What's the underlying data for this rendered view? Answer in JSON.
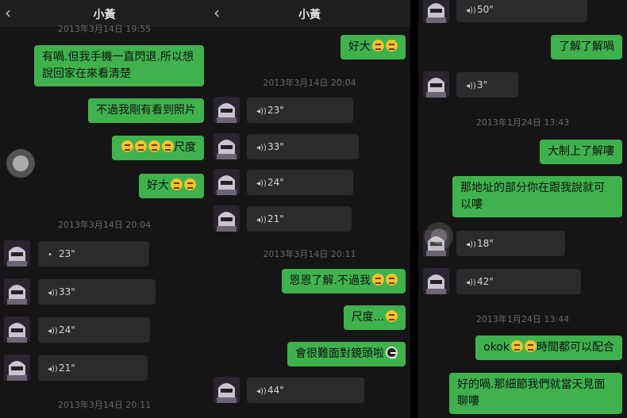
{
  "panel1": {
    "header": {
      "back_icon": "‹",
      "title": "小黃"
    },
    "timestamps": [
      "2013年3月14日 19:55",
      "2013年3月14日 20:04",
      "2013年3月14日 20:11"
    ],
    "messages": [
      "有喎.但我手機一直閃退.所以想說回家在來看清楚",
      "不過我剛有看到照片",
      "尺度",
      "好大"
    ],
    "voices": [
      "23\"",
      "33\"",
      "24\"",
      "21\""
    ]
  },
  "panel2": {
    "header": {
      "back_icon": "‹",
      "title": "小黃"
    },
    "timestamps": [
      "2013年3月14日 20:04",
      "2013年3月14日 20:11"
    ],
    "messages": [
      "好大",
      "恩恩了解.不過我",
      "尺度...",
      "會很難面對鏡頭啦"
    ],
    "voices": [
      "23\"",
      "33\"",
      "24\"",
      "21\"",
      "44\""
    ]
  },
  "panel3": {
    "timestamps": [
      "2013年1月24日 13:43",
      "2013年1月24日 13:44"
    ],
    "messages": [
      "了解了解喎",
      "大制上了解嘍",
      "那地址的部分你在跟我說就可以嘍",
      "okok",
      "時間都可以配合",
      "好的喎.那細節我們就當天見面聊嘍"
    ],
    "voices": [
      "50\"",
      "3\"",
      "18\"",
      "42\""
    ]
  },
  "icons": {
    "wave": "◂))",
    "emoji": "grimace-emoji",
    "avatar": "masked-character-avatar"
  },
  "colors": {
    "green_bubble": "#3fb24d",
    "voice_bubble": "#2b2b2b",
    "background": "#151515"
  }
}
